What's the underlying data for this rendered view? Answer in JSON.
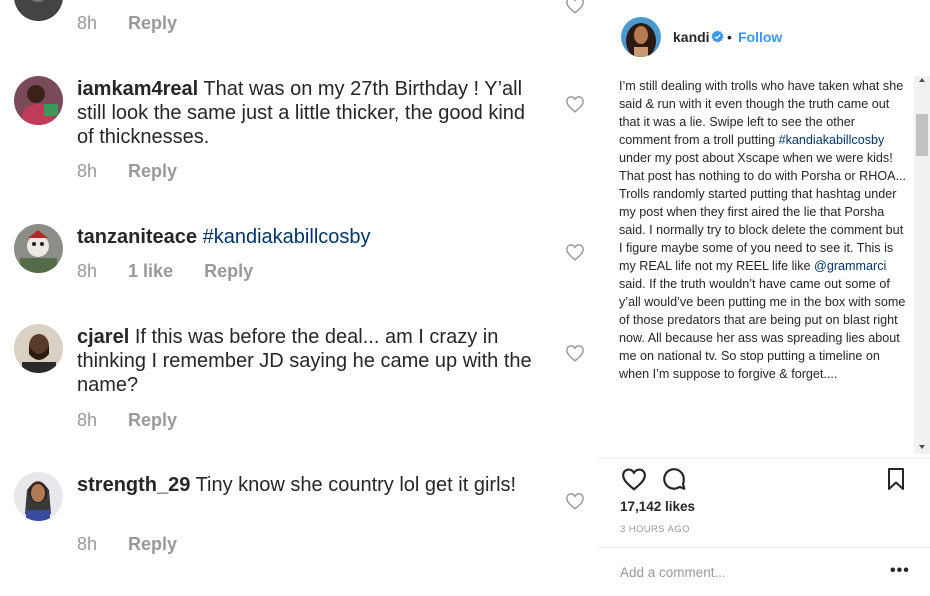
{
  "comments": [
    {
      "user": "",
      "text": "",
      "time": "8h",
      "likes": "",
      "reply": "Reply"
    },
    {
      "user": "iamkam4real",
      "text": " That was on my 27th Birthday ! Y’all still look the same just a little thicker, the good kind of thicknesses.",
      "time": "8h",
      "likes": "",
      "reply": "Reply"
    },
    {
      "user": "tanzaniteace",
      "tag": "#kandiakabillcosby",
      "time": "8h",
      "likes": "1 like",
      "reply": "Reply"
    },
    {
      "user": "cjarel",
      "text": " If this was before the deal... am I crazy in thinking I remember JD saying he came up with the name?",
      "time": "8h",
      "likes": "",
      "reply": "Reply"
    },
    {
      "user": "strength_29",
      "text": " Tiny know she country lol get it girls!",
      "time": "8h",
      "likes": "",
      "reply": "Reply"
    }
  ],
  "post": {
    "username": "kandi",
    "dot": "•",
    "follow": "Follow",
    "caption_1": "I’m still dealing with trolls who have taken what she said & run with it even though the truth came out that it was a lie. Swipe left to see the other comment from a troll putting ",
    "caption_tag": "#kandiakabillcosby",
    "caption_2": " under my post about Xscape when we were kids! That post has nothing to do with Porsha or RHOA... Trolls randomly started putting that hashtag under my post when they first aired the lie that Porsha said. I normally try to block delete the comment but I figure maybe some of you need to see it. This is my REAL life not my REEL life like ",
    "caption_mention": "@grammarci",
    "caption_3": " said. If the truth wouldn’t have came out some of y’all would’ve been putting me in the box with some of those predators that are being put on blast right now. All because her ass was spreading lies about me on national tv. So stop putting a timeline on when I’m suppose to forgive & forget....",
    "likes": "17,142 likes",
    "time": "3 HOURS AGO",
    "add_placeholder": "Add a comment...",
    "more": "•••"
  },
  "icons": {
    "like": "heart-outline",
    "comment": "speech-bubble",
    "save": "bookmark",
    "verified": "verified-badge"
  },
  "colors": {
    "link": "#3897f0",
    "hashtag": "#003569",
    "verified": "#3897f0",
    "meta": "#999999"
  }
}
